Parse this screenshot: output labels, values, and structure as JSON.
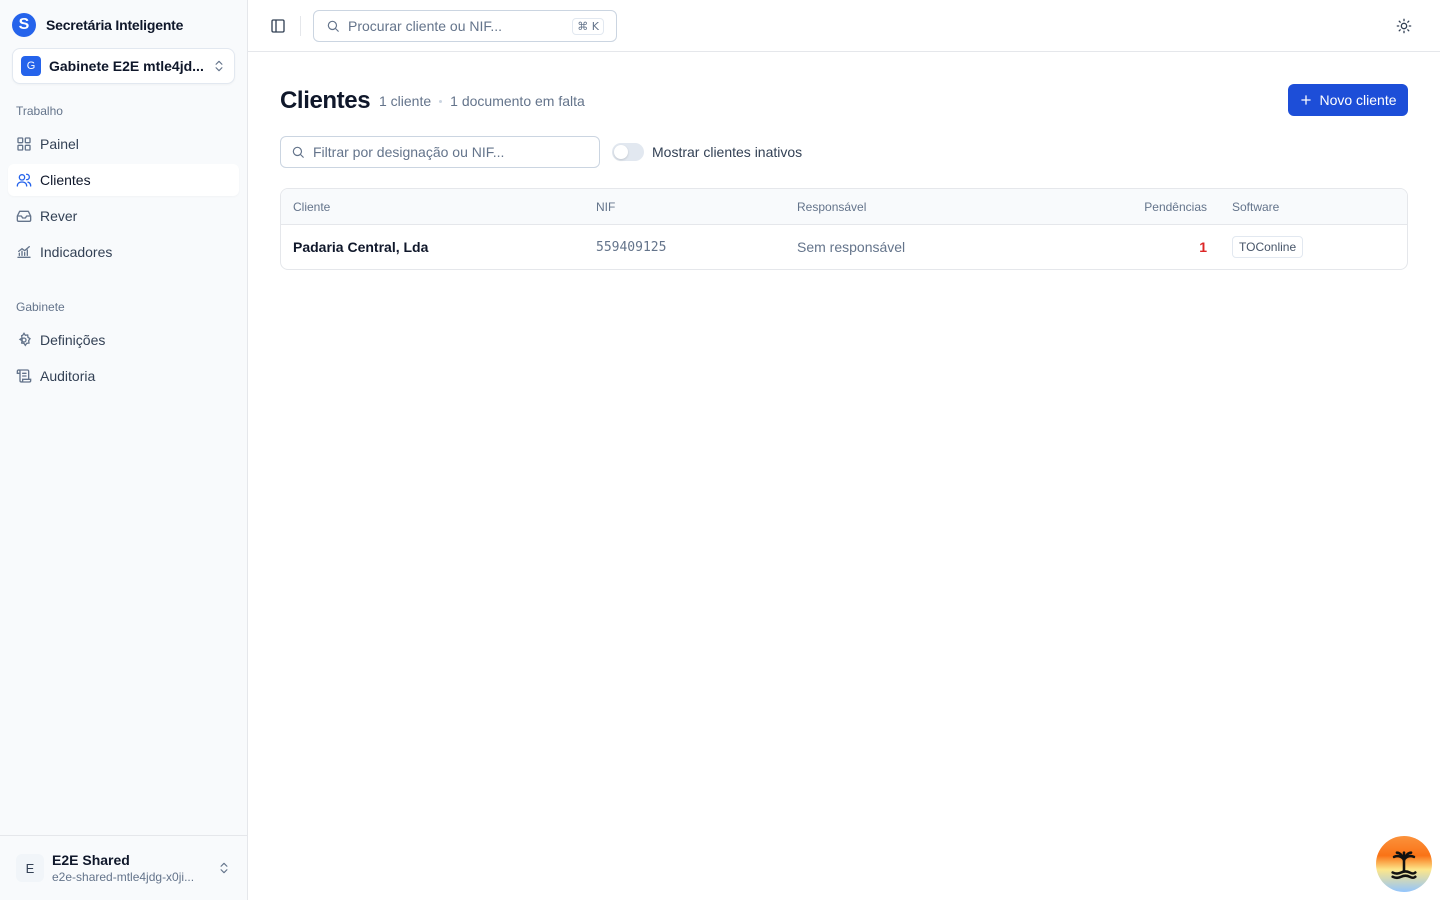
{
  "brand": {
    "name": "Secretária Inteligente",
    "logo_letter": "S"
  },
  "org": {
    "badge": "G",
    "name": "Gabinete E2E mtle4jd..."
  },
  "nav": {
    "section_work": "Trabalho",
    "items_work": [
      {
        "label": "Painel",
        "icon": "grid-icon"
      },
      {
        "label": "Clientes",
        "icon": "users-icon",
        "active": true
      },
      {
        "label": "Rever",
        "icon": "inbox-icon"
      },
      {
        "label": "Indicadores",
        "icon": "chart-icon"
      }
    ],
    "section_office": "Gabinete",
    "items_office": [
      {
        "label": "Definições",
        "icon": "gear-icon"
      },
      {
        "label": "Auditoria",
        "icon": "scroll-icon"
      }
    ]
  },
  "user": {
    "initial": "E",
    "name": "E2E Shared",
    "email": "e2e-shared-mtle4jdg-x0ji..."
  },
  "topbar": {
    "search_placeholder": "Procurar cliente ou NIF...",
    "shortcut": "⌘ K"
  },
  "page": {
    "title": "Clientes",
    "count": "1 cliente",
    "missing": "1 documento em falta",
    "new_button": "Novo cliente",
    "filter_placeholder": "Filtrar por designação ou NIF...",
    "toggle_label": "Mostrar clientes inativos",
    "toggle_on": false
  },
  "table": {
    "headers": {
      "cliente": "Cliente",
      "nif": "NIF",
      "responsavel": "Responsável",
      "pendencias": "Pendências",
      "software": "Software"
    },
    "rows": [
      {
        "cliente": "Padaria Central, Lda",
        "nif": "559409125",
        "responsavel": "Sem responsável",
        "pendencias": "1",
        "software": "TOConline"
      }
    ]
  },
  "colors": {
    "accent": "#2563eb",
    "button": "#1d4ed8",
    "danger": "#dc2626"
  }
}
